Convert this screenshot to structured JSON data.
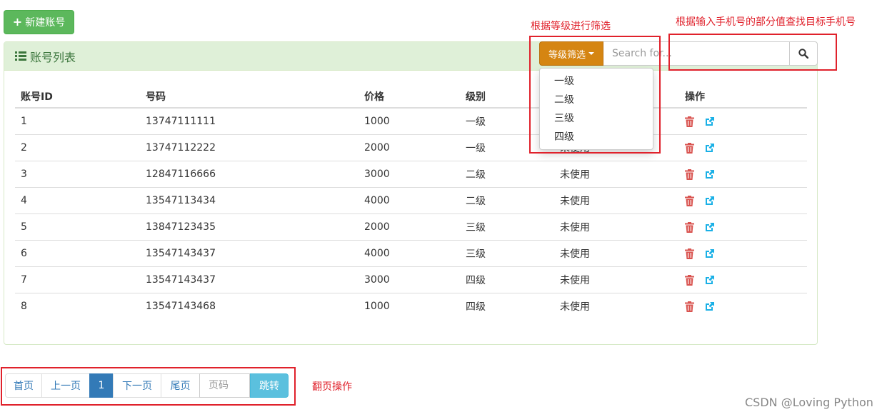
{
  "toolbar": {
    "new_account_label": "新建账号"
  },
  "panel": {
    "title": "账号列表"
  },
  "table": {
    "columns": [
      "账号ID",
      "号码",
      "价格",
      "级别",
      "",
      "操作"
    ],
    "rows": [
      {
        "id": "1",
        "number": "13747111111",
        "price": "1000",
        "level": "一级",
        "status": ""
      },
      {
        "id": "2",
        "number": "13747112222",
        "price": "2000",
        "level": "一级",
        "status": "未使用"
      },
      {
        "id": "3",
        "number": "12847116666",
        "price": "3000",
        "level": "二级",
        "status": "未使用"
      },
      {
        "id": "4",
        "number": "13547113434",
        "price": "4000",
        "level": "二级",
        "status": "未使用"
      },
      {
        "id": "5",
        "number": "13847123435",
        "price": "2000",
        "level": "三级",
        "status": "未使用"
      },
      {
        "id": "6",
        "number": "13547143437",
        "price": "4000",
        "level": "三级",
        "status": "未使用"
      },
      {
        "id": "7",
        "number": "13547143437",
        "price": "3000",
        "level": "四级",
        "status": "未使用"
      },
      {
        "id": "8",
        "number": "13547143468",
        "price": "1000",
        "level": "四级",
        "status": "未使用"
      }
    ],
    "row_icons": [
      "trash-icon",
      "external-link-icon"
    ]
  },
  "filter": {
    "button_label": "等级筛选",
    "options": [
      "一级",
      "二级",
      "三级",
      "四级"
    ]
  },
  "search": {
    "placeholder": "Search for..."
  },
  "annotations": {
    "filter_note": "根据等级进行筛选",
    "search_note": "根据输入手机号的部分值查找目标手机号",
    "pager_note": "翻页操作"
  },
  "pagination": {
    "first": "首页",
    "prev": "上一页",
    "current": "1",
    "next": "下一页",
    "last": "尾页",
    "page_placeholder": "页码",
    "jump_label": "跳转"
  },
  "watermark": "CSDN @Loving Python",
  "colors": {
    "success": "#5cb85c",
    "panel_heading_bg": "#dff0d8",
    "warning_btn": "#d58512",
    "primary": "#337ab7",
    "info": "#5bc0de",
    "danger_icon": "#d9534f",
    "link_icon": "#1ab0e6",
    "annotation_red": "#e0212b"
  }
}
